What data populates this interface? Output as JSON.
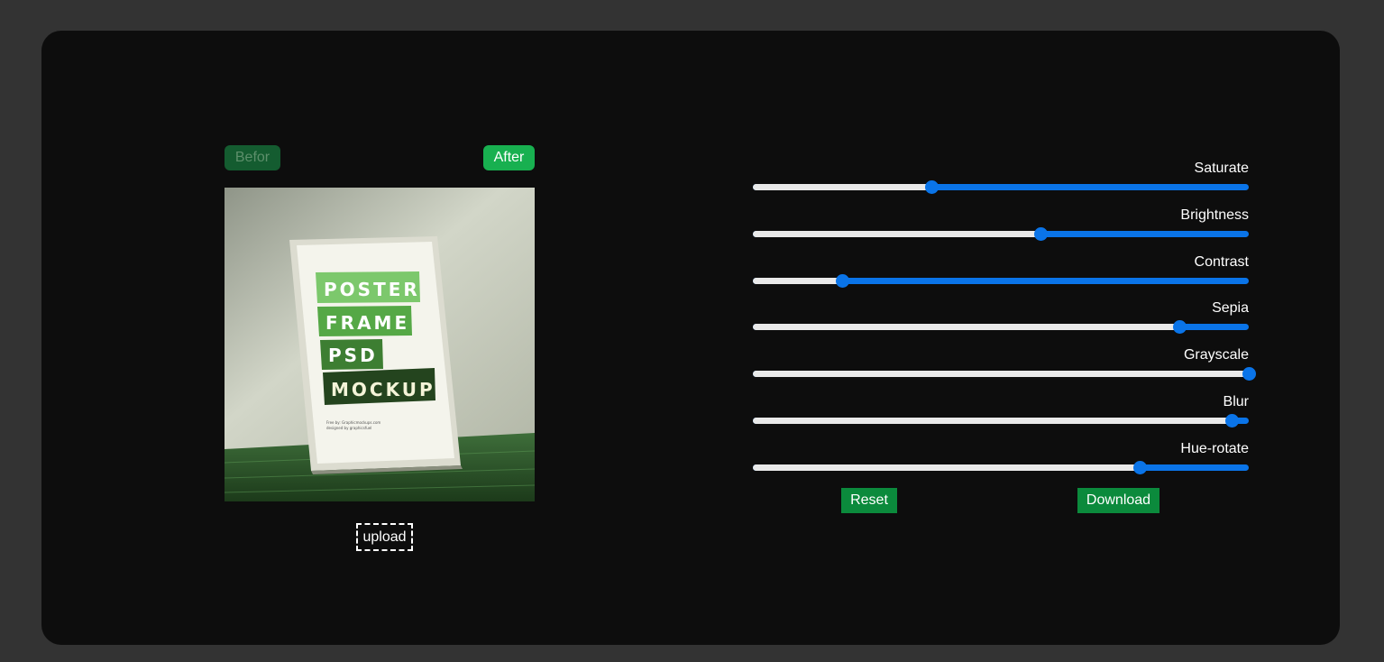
{
  "toggles": {
    "before_label": "Befor",
    "after_label": "After"
  },
  "image": {
    "poster_lines": [
      "POSTER",
      "FRAME",
      "PSD",
      "MOCKUP"
    ],
    "small_print": [
      "Free by: Graphicmockups.com",
      "designed by graphicsfuel"
    ]
  },
  "upload_label": "upload",
  "sliders": [
    {
      "label": "Saturate",
      "value": 0.36
    },
    {
      "label": "Brightness",
      "value": 0.58
    },
    {
      "label": "Contrast",
      "value": 0.18
    },
    {
      "label": "Sepia",
      "value": 0.86
    },
    {
      "label": "Grayscale",
      "value": 1.0
    },
    {
      "label": "Blur",
      "value": 0.965
    },
    {
      "label": "Hue-rotate",
      "value": 0.78
    }
  ],
  "actions": {
    "reset_label": "Reset",
    "download_label": "Download"
  },
  "colors": {
    "accent_blue": "#0a74e8",
    "green_active": "#18b050",
    "green_inactive": "#145c30",
    "green_action": "#0b8a3c",
    "card_bg": "#0d0d0d",
    "page_bg": "#333333"
  },
  "icons": {
    "preview": "poster-frame-mockup-image"
  }
}
